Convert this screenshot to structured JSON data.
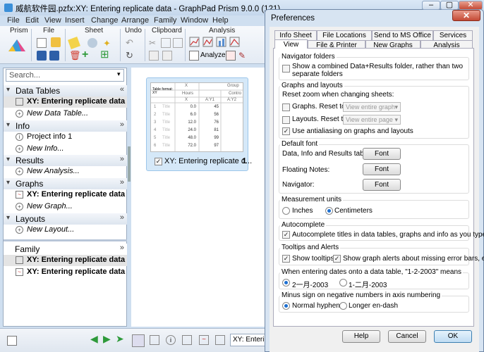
{
  "app": {
    "title": "威航软件园.pzfx:XY: Entering replicate data - GraphPad Prism 9.0.0 (121)"
  },
  "menu": [
    "File",
    "Edit",
    "View",
    "Insert",
    "Change",
    "Arrange",
    "Family",
    "Window",
    "Help"
  ],
  "ribbon": {
    "groups": [
      "Prism",
      "File",
      "Sheet",
      "Undo",
      "Clipboard",
      "Analysis"
    ],
    "analyze_label": "Analyze"
  },
  "navigator": {
    "search_placeholder": "Search...",
    "sections": [
      {
        "label": "Data Tables",
        "items": [
          "XY: Entering replicate data",
          "New Data Table..."
        ]
      },
      {
        "label": "Info",
        "items": [
          "Project info 1",
          "New Info..."
        ]
      },
      {
        "label": "Results",
        "items": [
          "New Analysis..."
        ]
      },
      {
        "label": "Graphs",
        "items": [
          "XY: Entering replicate data",
          "New Graph..."
        ]
      },
      {
        "label": "Layouts",
        "items": [
          "New Layout..."
        ]
      },
      {
        "label": "Family",
        "items": [
          "XY: Entering replicate data",
          "XY: Entering replicate data"
        ]
      }
    ]
  },
  "thumbnail": {
    "caption": "XY: Entering replicate d...",
    "count": "1",
    "table_format": "Table format: XY",
    "col_x": "X",
    "col_group": "Group",
    "hours": "Hours",
    "contro": "Contro",
    "sub_x": "X",
    "sub_ay1": "A:Y1",
    "sub_ay2": "A:Y2",
    "rows": [
      {
        "n": "1",
        "t": "Title",
        "x": "0.0",
        "y": "45"
      },
      {
        "n": "2",
        "t": "Title",
        "x": "6.0",
        "y": "56"
      },
      {
        "n": "3",
        "t": "Title",
        "x": "12.0",
        "y": "76"
      },
      {
        "n": "4",
        "t": "Title",
        "x": "24.0",
        "y": "81"
      },
      {
        "n": "5",
        "t": "Title",
        "x": "48.0",
        "y": "99"
      },
      {
        "n": "6",
        "t": "Title",
        "x": "72.0",
        "y": "97"
      }
    ]
  },
  "statusbar": {
    "sheet_label": "XY: Enterin"
  },
  "dialog": {
    "title": "Preferences",
    "tabs_row1": [
      "Info Sheet",
      "File Locations",
      "Send to MS Office",
      "Services"
    ],
    "tabs_row2": [
      "View",
      "File & Printer",
      "New Graphs",
      "Analysis"
    ],
    "active_tab": "View",
    "navigator_folders": {
      "title": "Navigator folders",
      "option": "Show a combined Data+Results folder, rather than two separate folders",
      "checked": false
    },
    "graphs_layouts": {
      "title": "Graphs and layouts",
      "zoom_label": "Reset zoom when changing sheets:",
      "graphs_label": "Graphs. Reset to",
      "graphs_value": "View entire graph",
      "layouts_label": "Layouts. Reset to",
      "layouts_value": "View entire page",
      "antialias": "Use antialiasing on graphs and layouts",
      "antialias_checked": true
    },
    "default_font": {
      "title": "Default font",
      "rows": [
        "Data, Info and Results tables:",
        "Floating Notes:",
        "Navigator:"
      ],
      "button": "Font"
    },
    "measurement": {
      "title": "Measurement units",
      "opt1": "Inches",
      "opt2": "Centimeters",
      "selected": "Centimeters"
    },
    "autocomplete": {
      "title": "Autocomplete",
      "option": "Autocomplete titles in data tables, graphs and info as you type",
      "checked": true
    },
    "tooltips": {
      "title": "Tooltips and Alerts",
      "opt1": "Show tooltips",
      "opt2": "Show graph alerts about missing error bars, etc.",
      "checked1": true,
      "checked2": true
    },
    "dates": {
      "title": "When entering dates onto a data table, \"1-2-2003\" means",
      "opt1": "2一月-2003",
      "opt2": "1-二月-2003",
      "selected": "2一月-2003"
    },
    "minus": {
      "title": "Minus sign on negative numbers in axis numbering",
      "opt1": "Normal hyphen",
      "opt2": "Longer en-dash",
      "selected": "Normal hyphen"
    },
    "buttons": {
      "help": "Help",
      "cancel": "Cancel",
      "ok": "OK"
    }
  },
  "colors": {
    "accent": "#1c6fd1",
    "window_frame": "#cfdff0",
    "thumb_selected": "#d5e8f8"
  }
}
